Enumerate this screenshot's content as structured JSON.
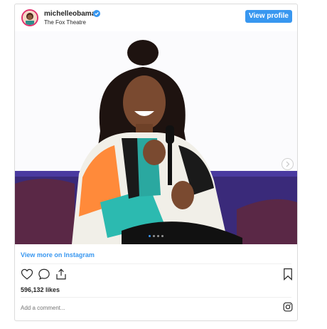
{
  "post": {
    "username": "michelleobama",
    "location": "The Fox Theatre",
    "view_profile_label": "View profile",
    "view_more_label": "View more on Instagram",
    "likes_text": "596,132 likes",
    "comment_placeholder": "Add a comment...",
    "carousel": {
      "count": 4,
      "active_index": 0
    }
  },
  "icons": {
    "verified": "verified-badge-icon",
    "next": "chevron-right-icon",
    "like": "heart-icon",
    "comment": "comment-bubble-icon",
    "share": "share-icon",
    "save": "bookmark-icon",
    "instagram": "instagram-logo-icon"
  },
  "colors": {
    "accent": "#3897f0",
    "text": "#262626",
    "muted": "#8e8e8e",
    "border": "#dbdbdb"
  }
}
